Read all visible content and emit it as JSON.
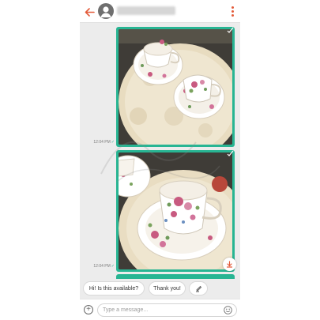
{
  "messages": [
    {
      "timestamp": "12:04 PM"
    },
    {
      "timestamp": "12:04 PM"
    }
  ],
  "quick_replies": [
    "Hi! Is this available?",
    "Thank you!"
  ],
  "composer": {
    "placeholder": "Type a message..."
  },
  "colors": {
    "accent": "#e35b3a",
    "bubble": "#28b593",
    "chat_background": "#ececec",
    "read_check": "#2aa88a"
  },
  "icons": [
    "back-arrow-icon",
    "avatar-icon",
    "more-vertical-icon",
    "double-check-icon",
    "download-icon",
    "edit-icon",
    "add-icon",
    "emoji-icon"
  ]
}
